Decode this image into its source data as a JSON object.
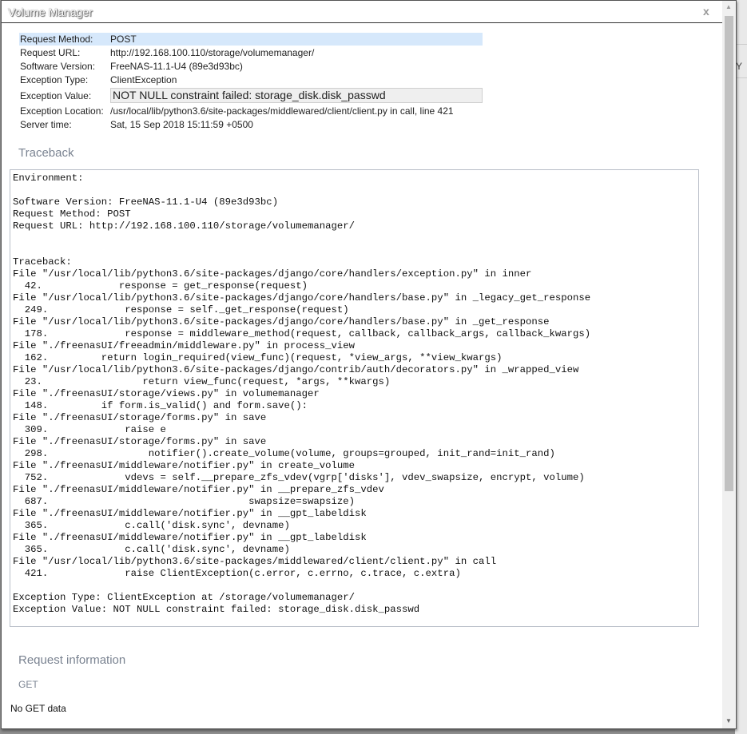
{
  "dialog": {
    "title": "Volume Manager",
    "close_label": "x"
  },
  "background": {
    "partial_text": "Y"
  },
  "summary": [
    {
      "label": "Request Method:",
      "value": "POST"
    },
    {
      "label": "Request URL:",
      "value": "http://192.168.100.110/storage/volumemanager/"
    },
    {
      "label": "Software Version:",
      "value": "FreeNAS-11.1-U4 (89e3d93bc)"
    },
    {
      "label": "Exception Type:",
      "value": "ClientException"
    },
    {
      "label": "Exception Value:",
      "value": "NOT NULL constraint failed: storage_disk.disk_passwd"
    },
    {
      "label": "Exception Location:",
      "value": "/usr/local/lib/python3.6/site-packages/middlewared/client/client.py in call, line 421"
    },
    {
      "label": "Server time:",
      "value": "Sat, 15 Sep 2018 15:11:59 +0500"
    }
  ],
  "traceback": {
    "heading": "Traceback",
    "text": "Environment:\n\nSoftware Version: FreeNAS-11.1-U4 (89e3d93bc)\nRequest Method: POST\nRequest URL: http://192.168.100.110/storage/volumemanager/\n\n\nTraceback:\nFile \"/usr/local/lib/python3.6/site-packages/django/core/handlers/exception.py\" in inner\n  42.             response = get_response(request)\nFile \"/usr/local/lib/python3.6/site-packages/django/core/handlers/base.py\" in _legacy_get_response\n  249.             response = self._get_response(request)\nFile \"/usr/local/lib/python3.6/site-packages/django/core/handlers/base.py\" in _get_response\n  178.             response = middleware_method(request, callback, callback_args, callback_kwargs)\nFile \"./freenasUI/freeadmin/middleware.py\" in process_view\n  162.         return login_required(view_func)(request, *view_args, **view_kwargs)\nFile \"/usr/local/lib/python3.6/site-packages/django/contrib/auth/decorators.py\" in _wrapped_view\n  23.                 return view_func(request, *args, **kwargs)\nFile \"./freenasUI/storage/views.py\" in volumemanager\n  148.         if form.is_valid() and form.save():\nFile \"./freenasUI/storage/forms.py\" in save\n  309.             raise e\nFile \"./freenasUI/storage/forms.py\" in save\n  298.                 notifier().create_volume(volume, groups=grouped, init_rand=init_rand)\nFile \"./freenasUI/middleware/notifier.py\" in create_volume\n  752.             vdevs = self.__prepare_zfs_vdev(vgrp['disks'], vdev_swapsize, encrypt, volume)\nFile \"./freenasUI/middleware/notifier.py\" in __prepare_zfs_vdev\n  687.                                  swapsize=swapsize)\nFile \"./freenasUI/middleware/notifier.py\" in __gpt_labeldisk\n  365.             c.call('disk.sync', devname)\nFile \"./freenasUI/middleware/notifier.py\" in __gpt_labeldisk\n  365.             c.call('disk.sync', devname)\nFile \"/usr/local/lib/python3.6/site-packages/middlewared/client/client.py\" in call\n  421.             raise ClientException(c.error, c.errno, c.trace, c.extra)\n\nException Type: ClientException at /storage/volumemanager/\nException Value: NOT NULL constraint failed: storage_disk.disk_passwd"
  },
  "request_info": {
    "heading": "Request information",
    "get_heading": "GET",
    "get_empty": "No GET data"
  }
}
